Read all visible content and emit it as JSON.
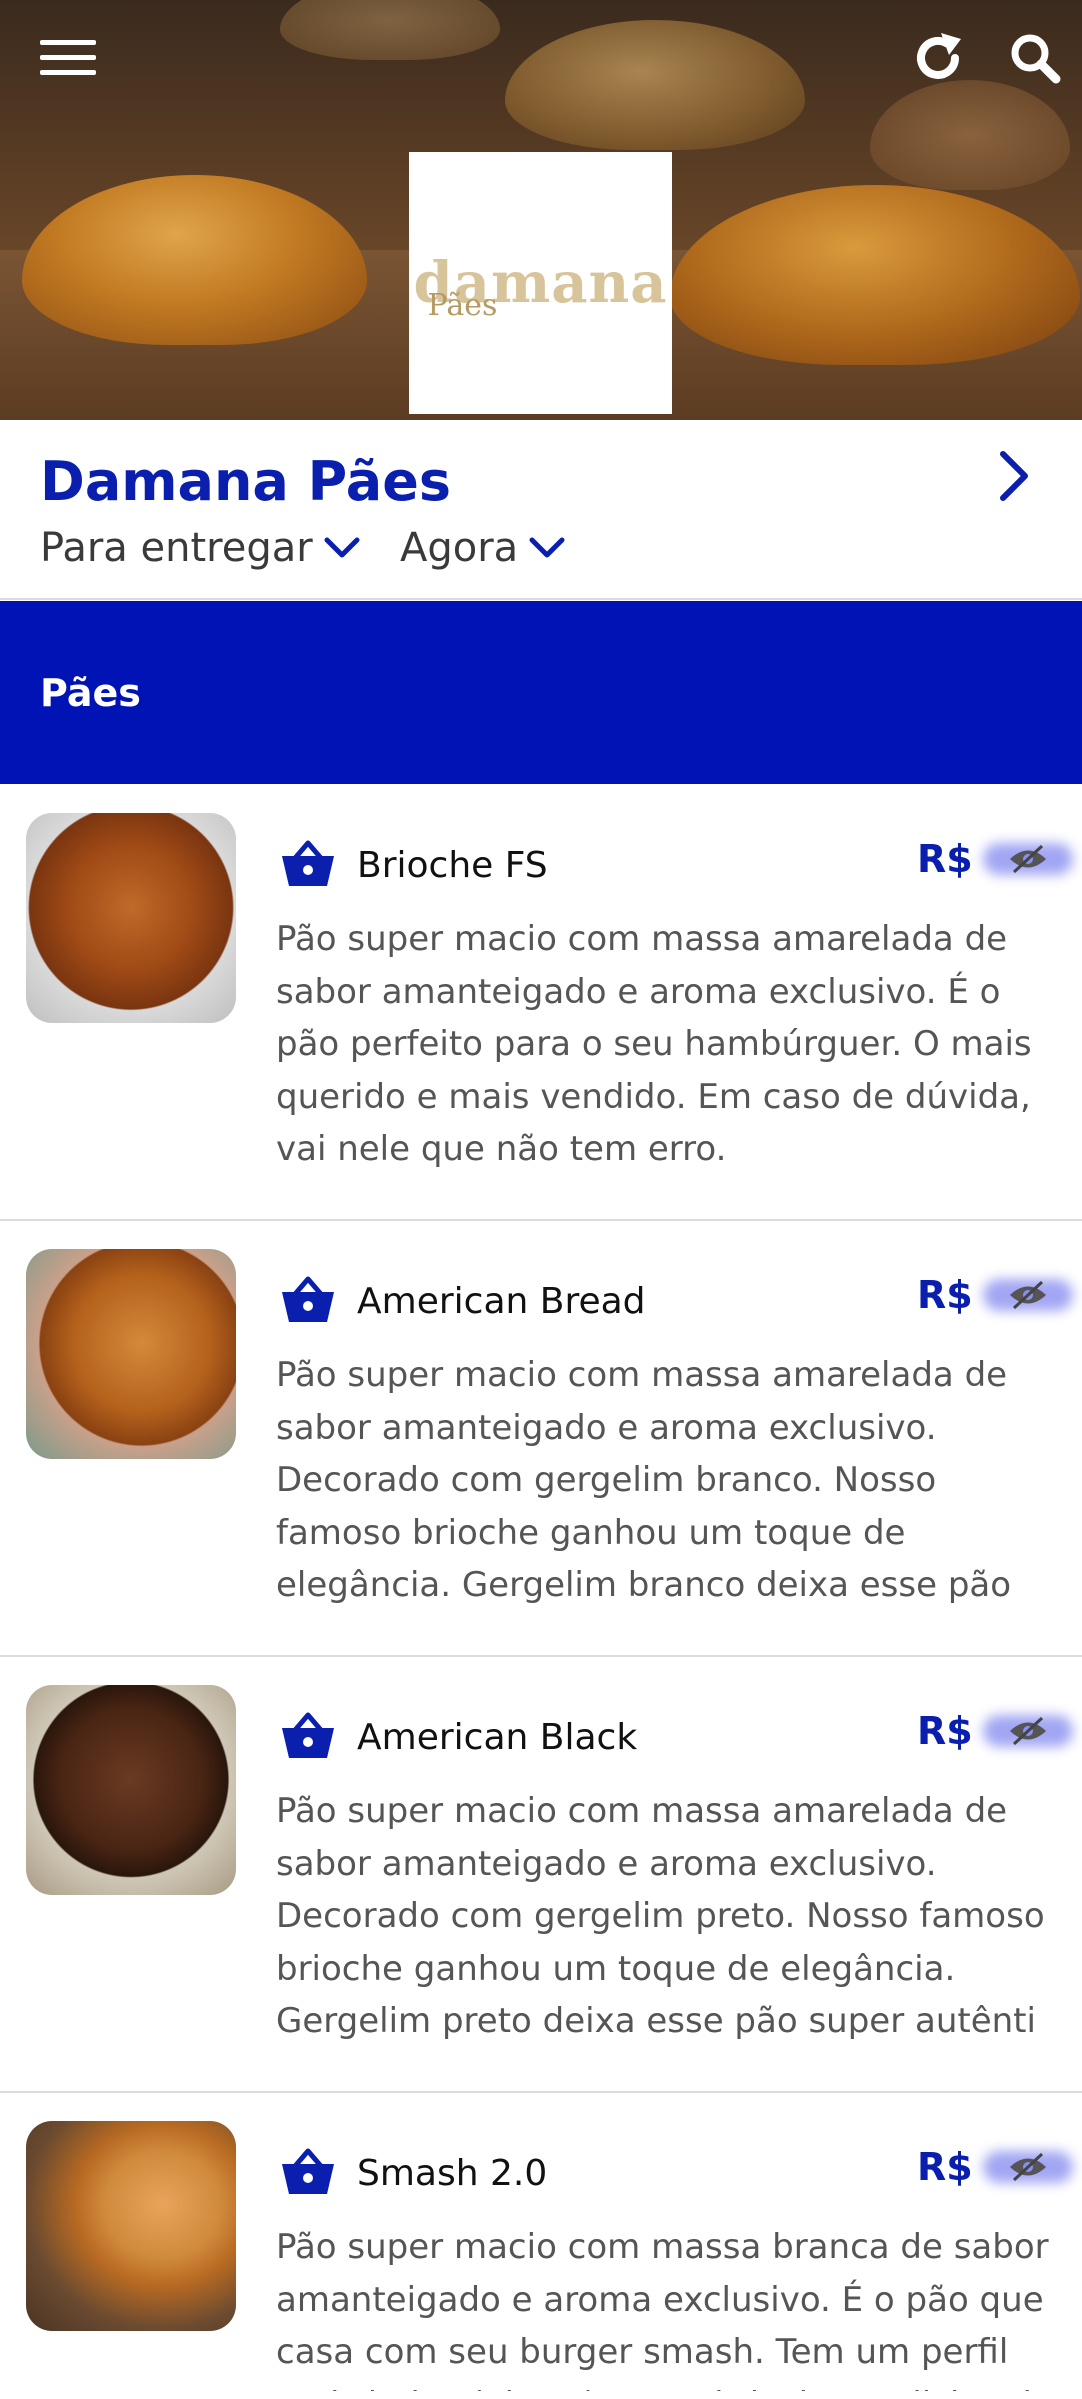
{
  "hero": {
    "logo_main": "damana",
    "logo_sub": "Pães",
    "icons": [
      "menu-icon",
      "refresh-icon",
      "search-icon"
    ]
  },
  "store": {
    "name": "Damana Pães",
    "delivery_label": "Para entregar",
    "time_label": "Agora"
  },
  "category": {
    "name": "Pães"
  },
  "products": [
    {
      "name": "Brioche FS",
      "currency": "R$",
      "description": "Pão super macio com massa amarelada de sabor amanteigado e aroma exclusivo. É o pão perfeito para o seu hambúrguer. O mais querido e mais vendido. Em caso de dúvida, vai nele que não tem erro."
    },
    {
      "name": "American Bread",
      "currency": "R$",
      "description": "Pão super macio com massa amarelada de sabor amanteigado e aroma exclusivo. Decorado com gergelim branco. Nosso famoso brioche ganhou um toque de elegância. Gergelim branco deixa esse pão idêntico ao"
    },
    {
      "name": "American Black",
      "currency": "R$",
      "description": "Pão super macio com massa amarelada de sabor amanteigado e aroma exclusivo. Decorado com gergelim preto. Nosso famoso brioche ganhou um toque de elegância. Gergelim preto deixa esse pão super autênti"
    },
    {
      "name": "Smash 2.0",
      "currency": "R$",
      "description": "Pão super macio com massa branca de sabor amanteigado e aroma exclusivo. É o pão que casa com seu burger smash. Tem um perfil mais baixo (altura) que o brioche tradicional, dando"
    }
  ],
  "colors": {
    "accent": "#0a1fae",
    "category_bg": "#0013b4"
  }
}
